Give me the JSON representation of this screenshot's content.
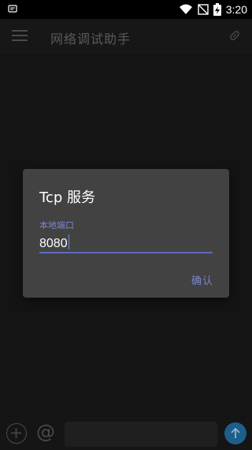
{
  "status_bar": {
    "time": "3:20",
    "icons": [
      "notification-icon",
      "wifi-icon",
      "no-sim-icon",
      "battery-charging-icon"
    ]
  },
  "toolbar": {
    "title": "网络调试助手",
    "menu_icon": "menu-icon",
    "clear_icon": "clear-icon"
  },
  "bottom_bar": {
    "add_icon": "add-icon",
    "at_label": "@",
    "input_value": "",
    "send_icon": "send-icon"
  },
  "dialog": {
    "title": "Tcp 服务",
    "field_label": "本地端口",
    "port_value": "8080",
    "confirm_label": "确认"
  },
  "colors": {
    "accent": "#7986cb",
    "dialog_bg": "#424242",
    "send_button": "#1e5e8a"
  }
}
